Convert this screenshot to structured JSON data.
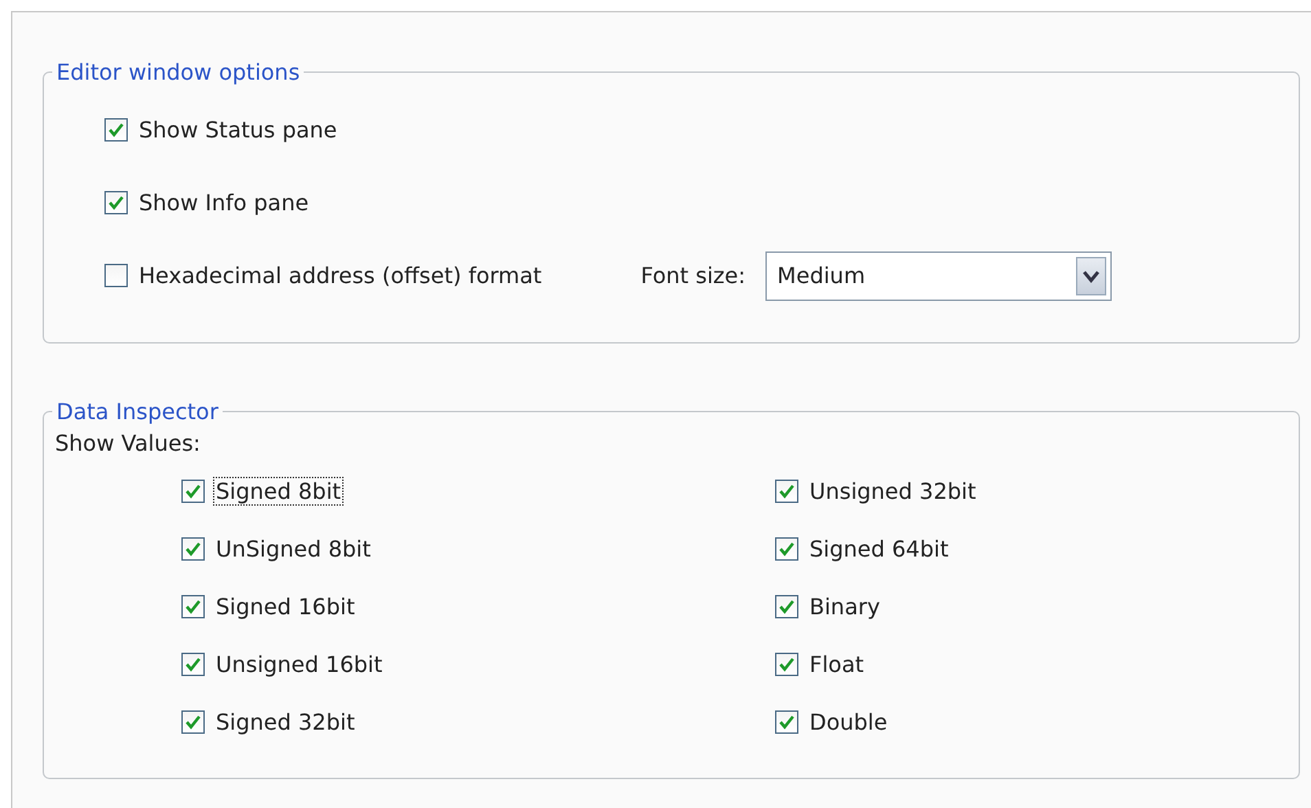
{
  "editor_options": {
    "title": "Editor window options",
    "checkboxes": [
      {
        "label": "Show Status pane",
        "checked": true
      },
      {
        "label": "Show Info pane",
        "checked": true
      },
      {
        "label": "Hexadecimal address (offset) format",
        "checked": false
      }
    ],
    "font_size": {
      "label": "Font size:",
      "value": "Medium"
    }
  },
  "data_inspector": {
    "title": "Data Inspector",
    "subtitle": "Show Values:",
    "columns": [
      [
        {
          "label": "Signed 8bit",
          "checked": true,
          "focused": true
        },
        {
          "label": "UnSigned 8bit",
          "checked": true,
          "focused": false
        },
        {
          "label": "Signed 16bit",
          "checked": true,
          "focused": false
        },
        {
          "label": "Unsigned 16bit",
          "checked": true,
          "focused": false
        },
        {
          "label": "Signed 32bit",
          "checked": true,
          "focused": false
        }
      ],
      [
        {
          "label": "Unsigned 32bit",
          "checked": true,
          "focused": false
        },
        {
          "label": "Signed 64bit",
          "checked": true,
          "focused": false
        },
        {
          "label": "Binary",
          "checked": true,
          "focused": false
        },
        {
          "label": "Float",
          "checked": true,
          "focused": false
        },
        {
          "label": "Double",
          "checked": true,
          "focused": false
        }
      ]
    ]
  }
}
